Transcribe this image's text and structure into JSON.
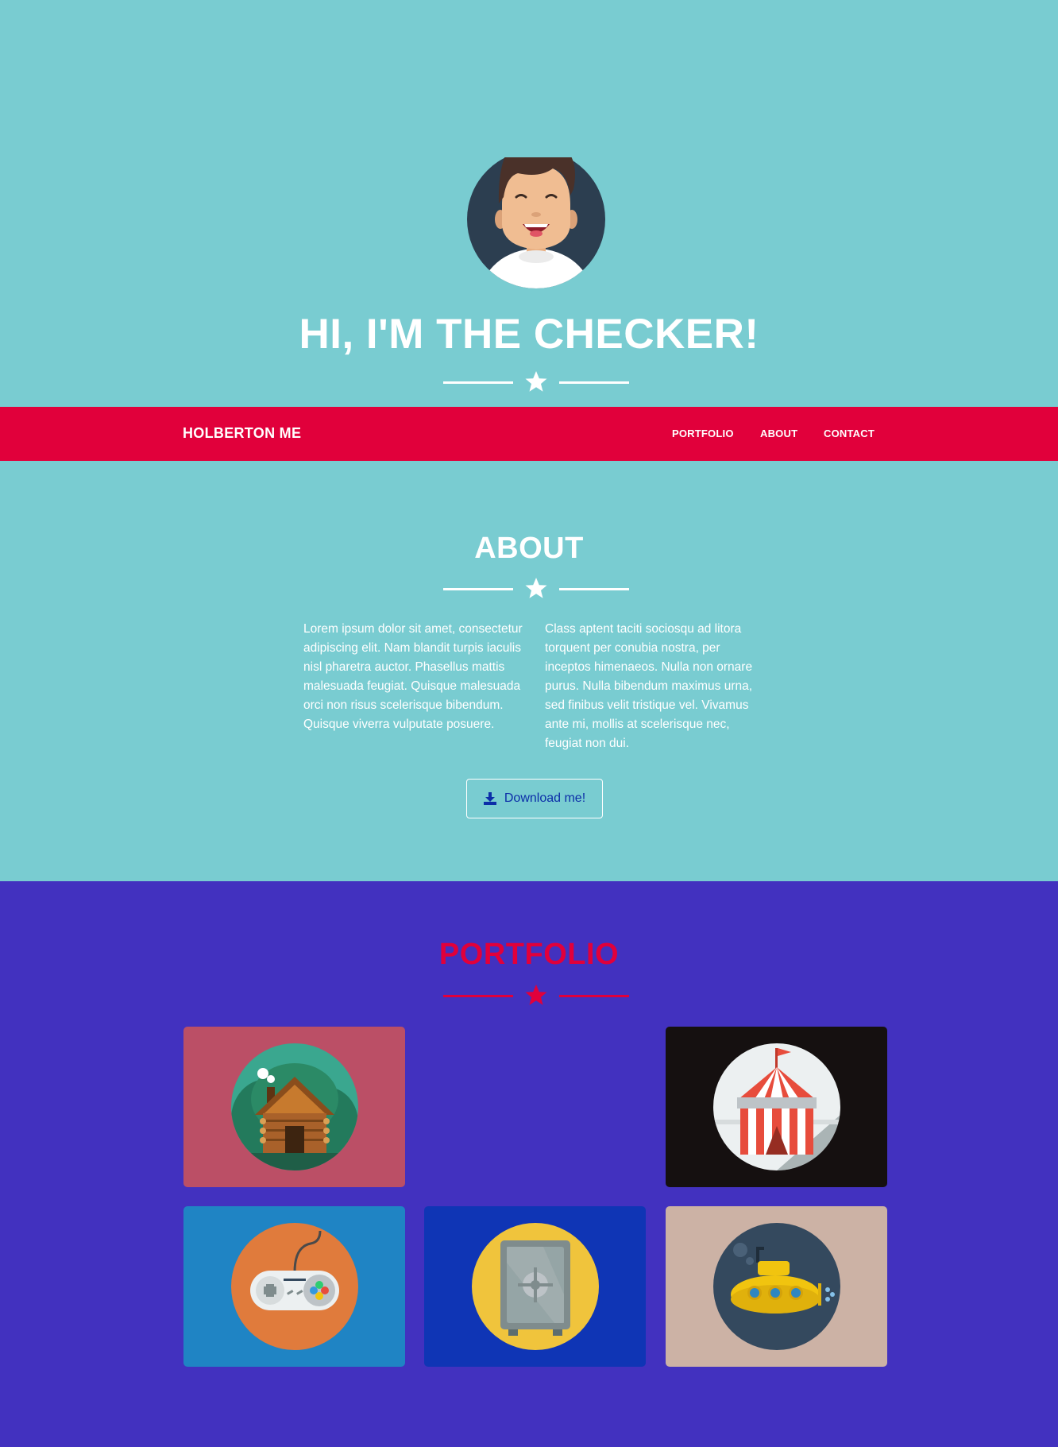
{
  "hero": {
    "title": "HI, I'M THE CHECKER!",
    "bg_color": "#79ccd1",
    "avatar_icon": "smiling-person-avatar-icon",
    "divider_icon": "star-icon"
  },
  "navbar": {
    "brand": "HOLBERTON ME",
    "bg_color": "#e1003b",
    "links": [
      {
        "label": "PORTFOLIO"
      },
      {
        "label": "ABOUT"
      },
      {
        "label": "CONTACT"
      }
    ]
  },
  "about": {
    "title": "ABOUT",
    "paragraph_left": "Lorem ipsum dolor sit amet, consectetur adipiscing elit. Nam blandit turpis iaculis nisl pharetra auctor. Phasellus mattis malesuada feugiat. Quisque malesuada orci non risus scelerisque bibendum. Quisque viverra vulputate posuere.",
    "paragraph_right": "Class aptent taciti sociosqu ad litora torquent per conubia nostra, per inceptos himenaeos. Nulla non ornare purus. Nulla bibendum maximus urna, sed finibus velit tristique vel. Vivamus ante mi, mollis at scelerisque nec, feugiat non dui.",
    "download_label": "Download me!",
    "download_icon": "download-icon"
  },
  "portfolio": {
    "title": "PORTFOLIO",
    "title_color": "#e1003b",
    "bg_color": "#4231bf",
    "items": [
      {
        "name": "cabin",
        "icon": "log-cabin-icon",
        "tile_color": "#bb4f66",
        "circle_color": "#3aa78f"
      },
      {
        "name": "circus",
        "icon": "circus-tent-icon",
        "tile_color": "#151010",
        "circle_color": "#ecf0f1"
      },
      {
        "name": "game",
        "icon": "game-controller-icon",
        "tile_color": "#1f84c4",
        "circle_color": "#e07b3c"
      },
      {
        "name": "safe",
        "icon": "safe-icon",
        "tile_color": "#0f35b5",
        "circle_color": "#f0c43c"
      },
      {
        "name": "submarine",
        "icon": "submarine-icon",
        "tile_color": "#ccb2a5",
        "circle_color": "#34495e"
      }
    ]
  }
}
